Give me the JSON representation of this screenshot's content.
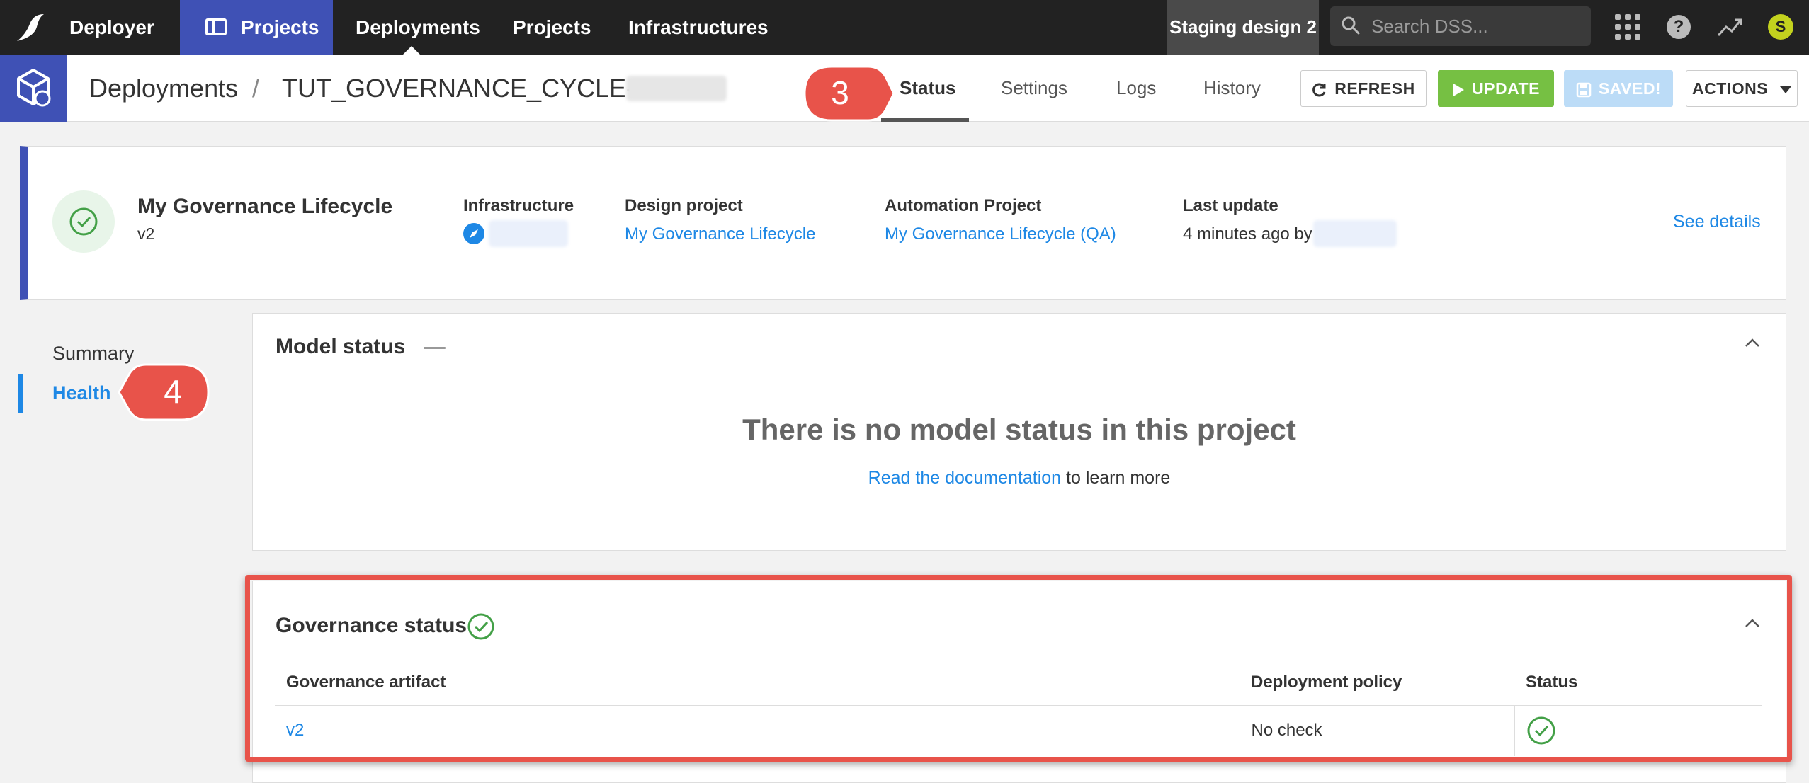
{
  "topnav": {
    "app_name": "Deployer",
    "projects_pill": "Projects",
    "links": [
      "Deployments",
      "Projects",
      "Infrastructures"
    ],
    "instance": "Staging design 2",
    "search_placeholder": "Search DSS...",
    "help": "?",
    "avatar_initial": "S"
  },
  "subheader": {
    "breadcrumb_root": "Deployments",
    "separator": "/",
    "deployment_name": "TUT_GOVERNANCE_CYCLE-on-",
    "tabs": [
      "Status",
      "Settings",
      "Logs",
      "History"
    ],
    "active_tab": "Status",
    "buttons": {
      "refresh": "REFRESH",
      "update": "UPDATE",
      "saved": "SAVED!",
      "actions": "ACTIONS"
    }
  },
  "callouts": {
    "step3": "3",
    "step4": "4"
  },
  "summary": {
    "title": "My Governance Lifecycle",
    "version": "v2",
    "infrastructure_label": "Infrastructure",
    "design_project_label": "Design project",
    "design_project": "My Governance Lifecycle",
    "automation_project_label": "Automation Project",
    "automation_project": "My Governance Lifecycle (QA)",
    "last_update_label": "Last update",
    "last_update": "4 minutes ago by",
    "see_details": "See details"
  },
  "sidebar": {
    "items": [
      "Summary",
      "Health"
    ],
    "active": "Health"
  },
  "model_status": {
    "title": "Model status",
    "dash": "—",
    "empty_title": "There is no model status in this project",
    "doc_link": "Read the documentation",
    "doc_suffix": " to learn more"
  },
  "governance_status": {
    "title": "Governance status",
    "columns": [
      "Governance artifact",
      "Deployment policy",
      "Status"
    ],
    "rows": [
      {
        "artifact": "v2",
        "policy": "No check",
        "status": "ok"
      }
    ]
  },
  "colors": {
    "accent": "#3f51b5",
    "link": "#1e88e5",
    "success": "#43a047",
    "update_button": "#76c043",
    "callout": "#e8534a"
  }
}
